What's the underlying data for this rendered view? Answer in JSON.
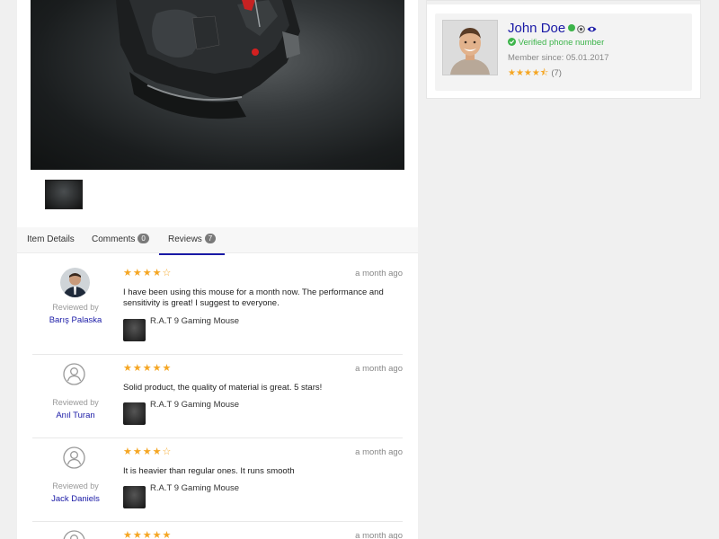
{
  "gallery": {
    "main_image": "gaming-mouse-photo",
    "thumbnails": [
      "gaming-mouse-thumbnail"
    ]
  },
  "tabs": [
    {
      "label": "Item Details",
      "count": null,
      "active": false
    },
    {
      "label": "Comments",
      "count": "0",
      "active": false
    },
    {
      "label": "Reviews",
      "count": "7",
      "active": true
    }
  ],
  "reviews": [
    {
      "rating": "★★★★☆",
      "rating_value": 4,
      "time": "a month ago",
      "text": "I have been using this mouse for a month now. The performance and sensitivity is great! I suggest to everyone.",
      "reviewed_by": "Reviewed by",
      "reviewer": "Barış Palaska",
      "has_photo": true,
      "product": "R.A.T 9 Gaming Mouse"
    },
    {
      "rating": "★★★★★",
      "rating_value": 5,
      "time": "a month ago",
      "text": "Solid product, the quality of material is great. 5 stars!",
      "reviewed_by": "Reviewed by",
      "reviewer": "Anıl Turan",
      "has_photo": false,
      "product": "R.A.T 9 Gaming Mouse"
    },
    {
      "rating": "★★★★☆",
      "rating_value": 4,
      "time": "a month ago",
      "text": "It is heavier than regular ones. It runs smooth",
      "reviewed_by": "Reviewed by",
      "reviewer": "Jack Daniels",
      "has_photo": false,
      "product": "R.A.T 9 Gaming Mouse"
    },
    {
      "rating": "★★★★★",
      "rating_value": 5,
      "time": "a month ago"
    }
  ],
  "seller": {
    "name": "John Doe",
    "verified": "Verified phone number",
    "member_since": "Member since: 05.01.2017",
    "rating": "★★★★⯪",
    "rating_value": 4.5,
    "rating_count": "(7)",
    "online": true
  },
  "colors": {
    "link": "#1a1aa6",
    "star": "#f5a623",
    "verified": "#3cb44a",
    "online": "#3cb44a"
  }
}
